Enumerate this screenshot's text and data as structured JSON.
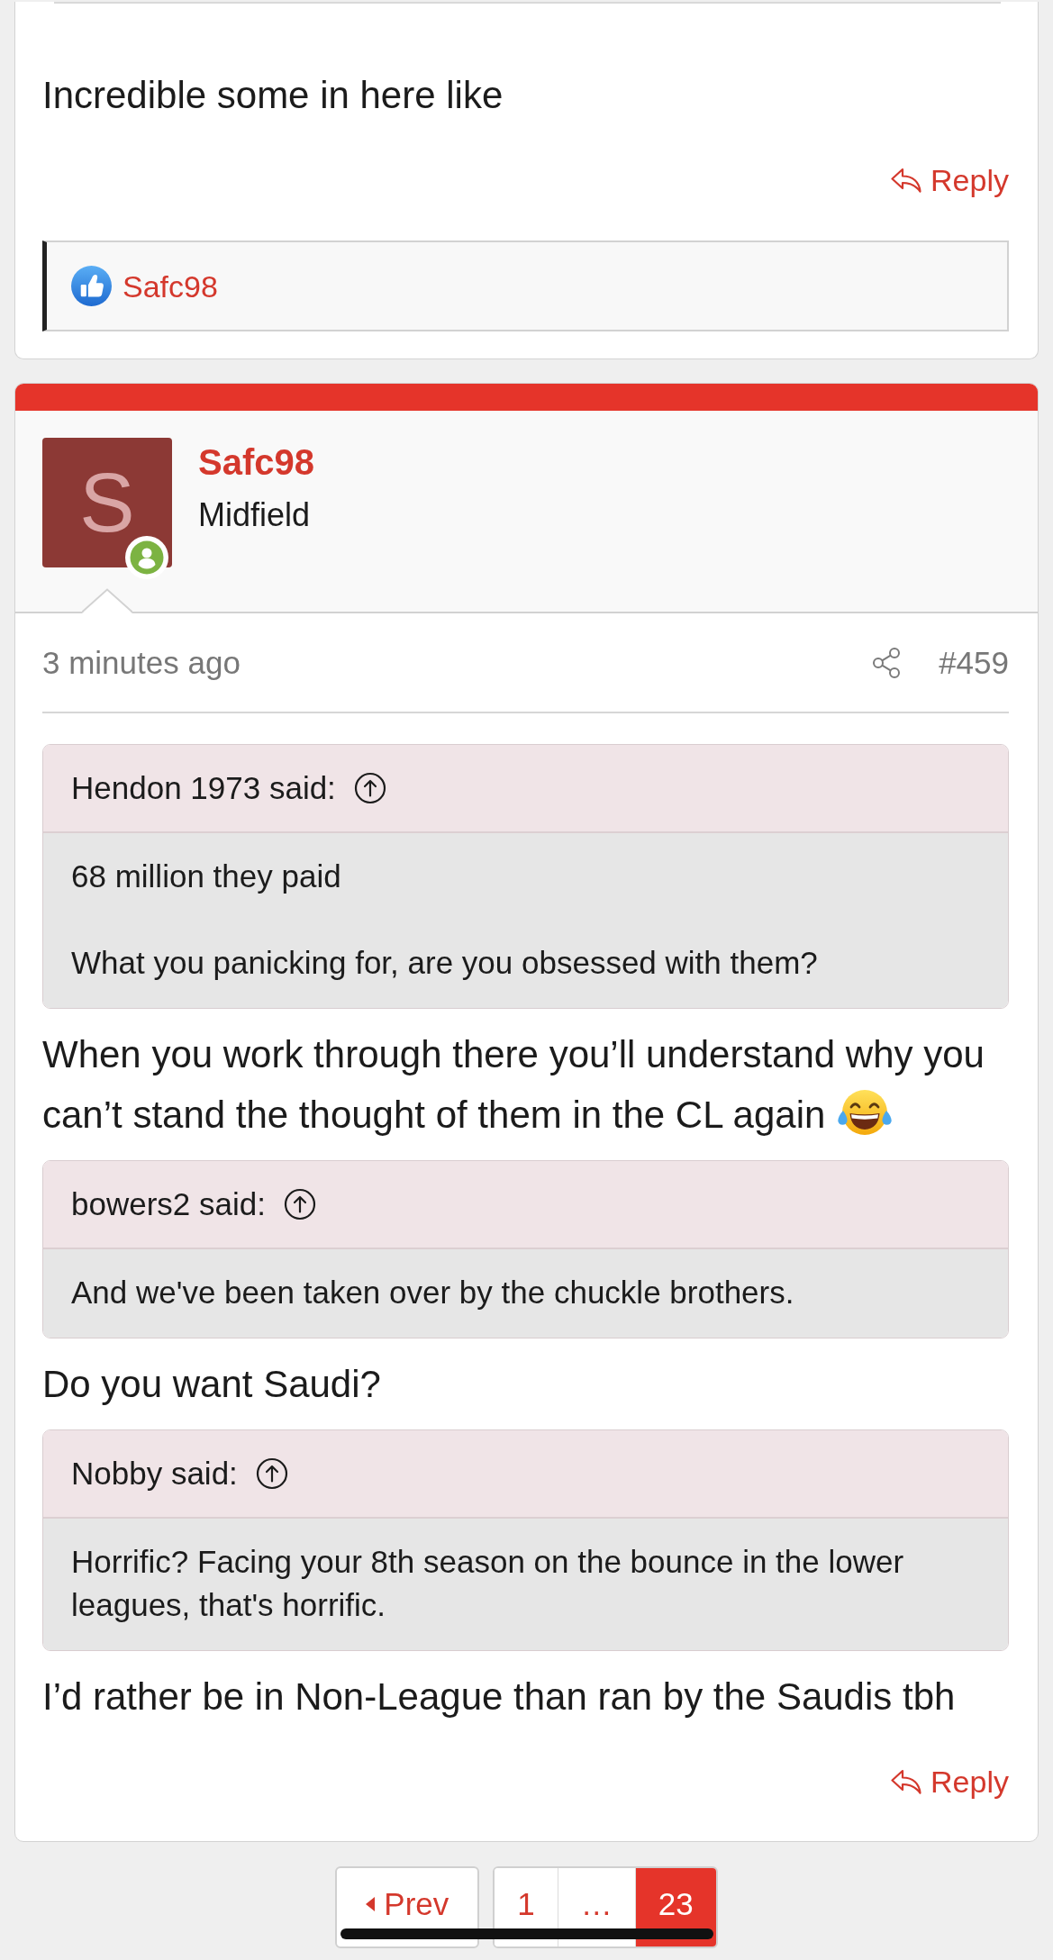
{
  "previous_post": {
    "message": "Incredible some in here like",
    "reply_label": "Reply",
    "reactions": {
      "users": [
        "Safc98"
      ]
    }
  },
  "post": {
    "author": {
      "name": "Safc98",
      "initial": "S",
      "title": "Midfield",
      "online": true
    },
    "time": "3 minutes ago",
    "number": "#459",
    "content": [
      {
        "kind": "quote",
        "author": "Hendon 1973 said:",
        "paragraphs": [
          "68 million they paid",
          "What you panicking for, are you obsessed with them?"
        ]
      },
      {
        "kind": "text",
        "text": "When you work through there you’ll understand why you can’t stand the thought of them in the CL again",
        "trailing_emoji": true
      },
      {
        "kind": "quote",
        "author": "bowers2 said:",
        "paragraphs": [
          "And we've been taken over by the chuckle brothers."
        ]
      },
      {
        "kind": "text",
        "text": "Do you want Saudi?",
        "trailing_emoji": false
      },
      {
        "kind": "quote",
        "author": "Nobby said:",
        "paragraphs": [
          "Horrific? Facing your 8th season on the bounce in the lower leagues, that's horrific."
        ]
      },
      {
        "kind": "text",
        "text": "I’d rather be in Non-League than ran by the Saudis tbh",
        "trailing_emoji": false
      }
    ],
    "reply_label": "Reply"
  },
  "pagination": {
    "prev_label": "Prev",
    "pages": [
      {
        "label": "1",
        "selected": false
      },
      {
        "label": "…",
        "selected": false
      },
      {
        "label": "23",
        "selected": true
      }
    ]
  }
}
